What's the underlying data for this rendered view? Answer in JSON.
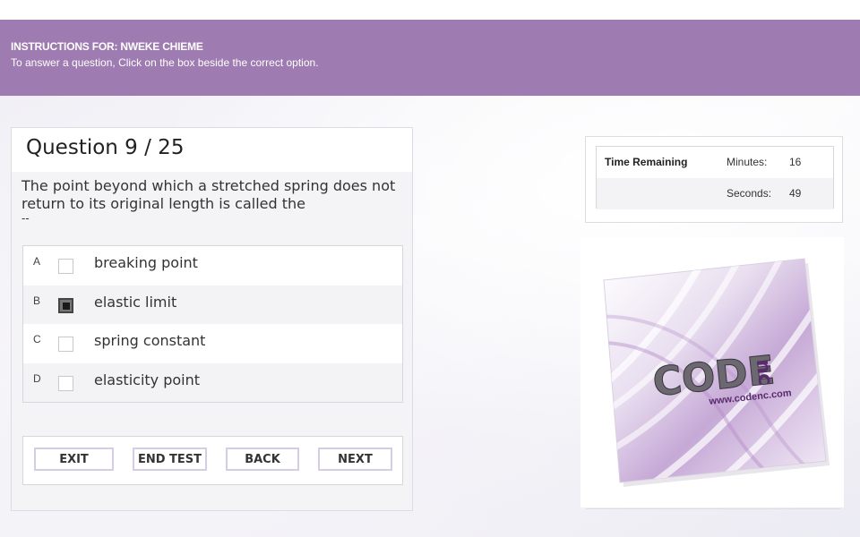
{
  "header": {
    "title": "INSTRUCTIONS FOR: NWEKE CHIEME",
    "instructions": "To answer a question, Click on the box beside the correct option."
  },
  "question": {
    "heading": "Question 9 / 25",
    "text_line1": "The point beyond which a stretched spring does not",
    "text_line2": "return to its original length is called the",
    "text_line3": "--",
    "options": [
      {
        "letter": "A",
        "text": "breaking point",
        "checked": false
      },
      {
        "letter": "B",
        "text": "elastic limit",
        "checked": true
      },
      {
        "letter": "C",
        "text": "spring constant",
        "checked": false
      },
      {
        "letter": "D",
        "text": "elasticity point",
        "checked": false
      }
    ]
  },
  "buttons": {
    "exit": "EXIT",
    "end_test": "END TEST",
    "back": "BACK",
    "next": "NEXT"
  },
  "timer": {
    "label": "Time Remaining",
    "minutes_label": "Minutes:",
    "minutes_value": "16",
    "seconds_label": "Seconds:",
    "seconds_value": "49"
  },
  "logo": {
    "wordmark": "CODEnc",
    "url": "www.codenc.com"
  },
  "colors": {
    "header_bg": "#9e7bb0",
    "logo_purple": "#5b2a6e"
  }
}
